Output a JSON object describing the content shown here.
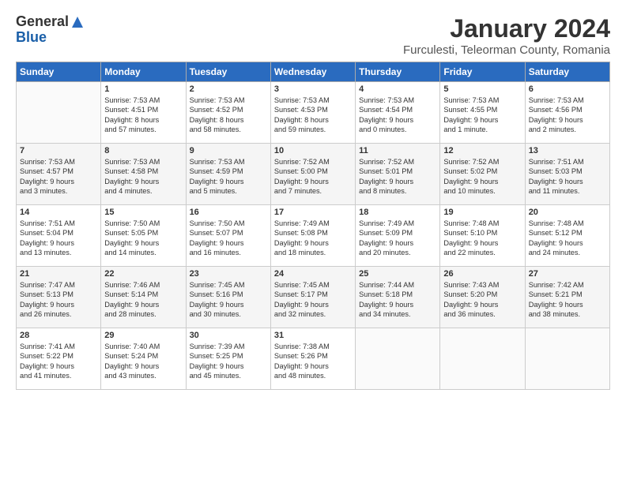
{
  "logo": {
    "general": "General",
    "blue": "Blue"
  },
  "title": "January 2024",
  "subtitle": "Furculesti, Teleorman County, Romania",
  "days_of_week": [
    "Sunday",
    "Monday",
    "Tuesday",
    "Wednesday",
    "Thursday",
    "Friday",
    "Saturday"
  ],
  "weeks": [
    [
      {
        "day": "",
        "text": ""
      },
      {
        "day": "1",
        "text": "Sunrise: 7:53 AM\nSunset: 4:51 PM\nDaylight: 8 hours\nand 57 minutes."
      },
      {
        "day": "2",
        "text": "Sunrise: 7:53 AM\nSunset: 4:52 PM\nDaylight: 8 hours\nand 58 minutes."
      },
      {
        "day": "3",
        "text": "Sunrise: 7:53 AM\nSunset: 4:53 PM\nDaylight: 8 hours\nand 59 minutes."
      },
      {
        "day": "4",
        "text": "Sunrise: 7:53 AM\nSunset: 4:54 PM\nDaylight: 9 hours\nand 0 minutes."
      },
      {
        "day": "5",
        "text": "Sunrise: 7:53 AM\nSunset: 4:55 PM\nDaylight: 9 hours\nand 1 minute."
      },
      {
        "day": "6",
        "text": "Sunrise: 7:53 AM\nSunset: 4:56 PM\nDaylight: 9 hours\nand 2 minutes."
      }
    ],
    [
      {
        "day": "7",
        "text": "Sunrise: 7:53 AM\nSunset: 4:57 PM\nDaylight: 9 hours\nand 3 minutes."
      },
      {
        "day": "8",
        "text": "Sunrise: 7:53 AM\nSunset: 4:58 PM\nDaylight: 9 hours\nand 4 minutes."
      },
      {
        "day": "9",
        "text": "Sunrise: 7:53 AM\nSunset: 4:59 PM\nDaylight: 9 hours\nand 5 minutes."
      },
      {
        "day": "10",
        "text": "Sunrise: 7:52 AM\nSunset: 5:00 PM\nDaylight: 9 hours\nand 7 minutes."
      },
      {
        "day": "11",
        "text": "Sunrise: 7:52 AM\nSunset: 5:01 PM\nDaylight: 9 hours\nand 8 minutes."
      },
      {
        "day": "12",
        "text": "Sunrise: 7:52 AM\nSunset: 5:02 PM\nDaylight: 9 hours\nand 10 minutes."
      },
      {
        "day": "13",
        "text": "Sunrise: 7:51 AM\nSunset: 5:03 PM\nDaylight: 9 hours\nand 11 minutes."
      }
    ],
    [
      {
        "day": "14",
        "text": "Sunrise: 7:51 AM\nSunset: 5:04 PM\nDaylight: 9 hours\nand 13 minutes."
      },
      {
        "day": "15",
        "text": "Sunrise: 7:50 AM\nSunset: 5:05 PM\nDaylight: 9 hours\nand 14 minutes."
      },
      {
        "day": "16",
        "text": "Sunrise: 7:50 AM\nSunset: 5:07 PM\nDaylight: 9 hours\nand 16 minutes."
      },
      {
        "day": "17",
        "text": "Sunrise: 7:49 AM\nSunset: 5:08 PM\nDaylight: 9 hours\nand 18 minutes."
      },
      {
        "day": "18",
        "text": "Sunrise: 7:49 AM\nSunset: 5:09 PM\nDaylight: 9 hours\nand 20 minutes."
      },
      {
        "day": "19",
        "text": "Sunrise: 7:48 AM\nSunset: 5:10 PM\nDaylight: 9 hours\nand 22 minutes."
      },
      {
        "day": "20",
        "text": "Sunrise: 7:48 AM\nSunset: 5:12 PM\nDaylight: 9 hours\nand 24 minutes."
      }
    ],
    [
      {
        "day": "21",
        "text": "Sunrise: 7:47 AM\nSunset: 5:13 PM\nDaylight: 9 hours\nand 26 minutes."
      },
      {
        "day": "22",
        "text": "Sunrise: 7:46 AM\nSunset: 5:14 PM\nDaylight: 9 hours\nand 28 minutes."
      },
      {
        "day": "23",
        "text": "Sunrise: 7:45 AM\nSunset: 5:16 PM\nDaylight: 9 hours\nand 30 minutes."
      },
      {
        "day": "24",
        "text": "Sunrise: 7:45 AM\nSunset: 5:17 PM\nDaylight: 9 hours\nand 32 minutes."
      },
      {
        "day": "25",
        "text": "Sunrise: 7:44 AM\nSunset: 5:18 PM\nDaylight: 9 hours\nand 34 minutes."
      },
      {
        "day": "26",
        "text": "Sunrise: 7:43 AM\nSunset: 5:20 PM\nDaylight: 9 hours\nand 36 minutes."
      },
      {
        "day": "27",
        "text": "Sunrise: 7:42 AM\nSunset: 5:21 PM\nDaylight: 9 hours\nand 38 minutes."
      }
    ],
    [
      {
        "day": "28",
        "text": "Sunrise: 7:41 AM\nSunset: 5:22 PM\nDaylight: 9 hours\nand 41 minutes."
      },
      {
        "day": "29",
        "text": "Sunrise: 7:40 AM\nSunset: 5:24 PM\nDaylight: 9 hours\nand 43 minutes."
      },
      {
        "day": "30",
        "text": "Sunrise: 7:39 AM\nSunset: 5:25 PM\nDaylight: 9 hours\nand 45 minutes."
      },
      {
        "day": "31",
        "text": "Sunrise: 7:38 AM\nSunset: 5:26 PM\nDaylight: 9 hours\nand 48 minutes."
      },
      {
        "day": "",
        "text": ""
      },
      {
        "day": "",
        "text": ""
      },
      {
        "day": "",
        "text": ""
      }
    ]
  ]
}
